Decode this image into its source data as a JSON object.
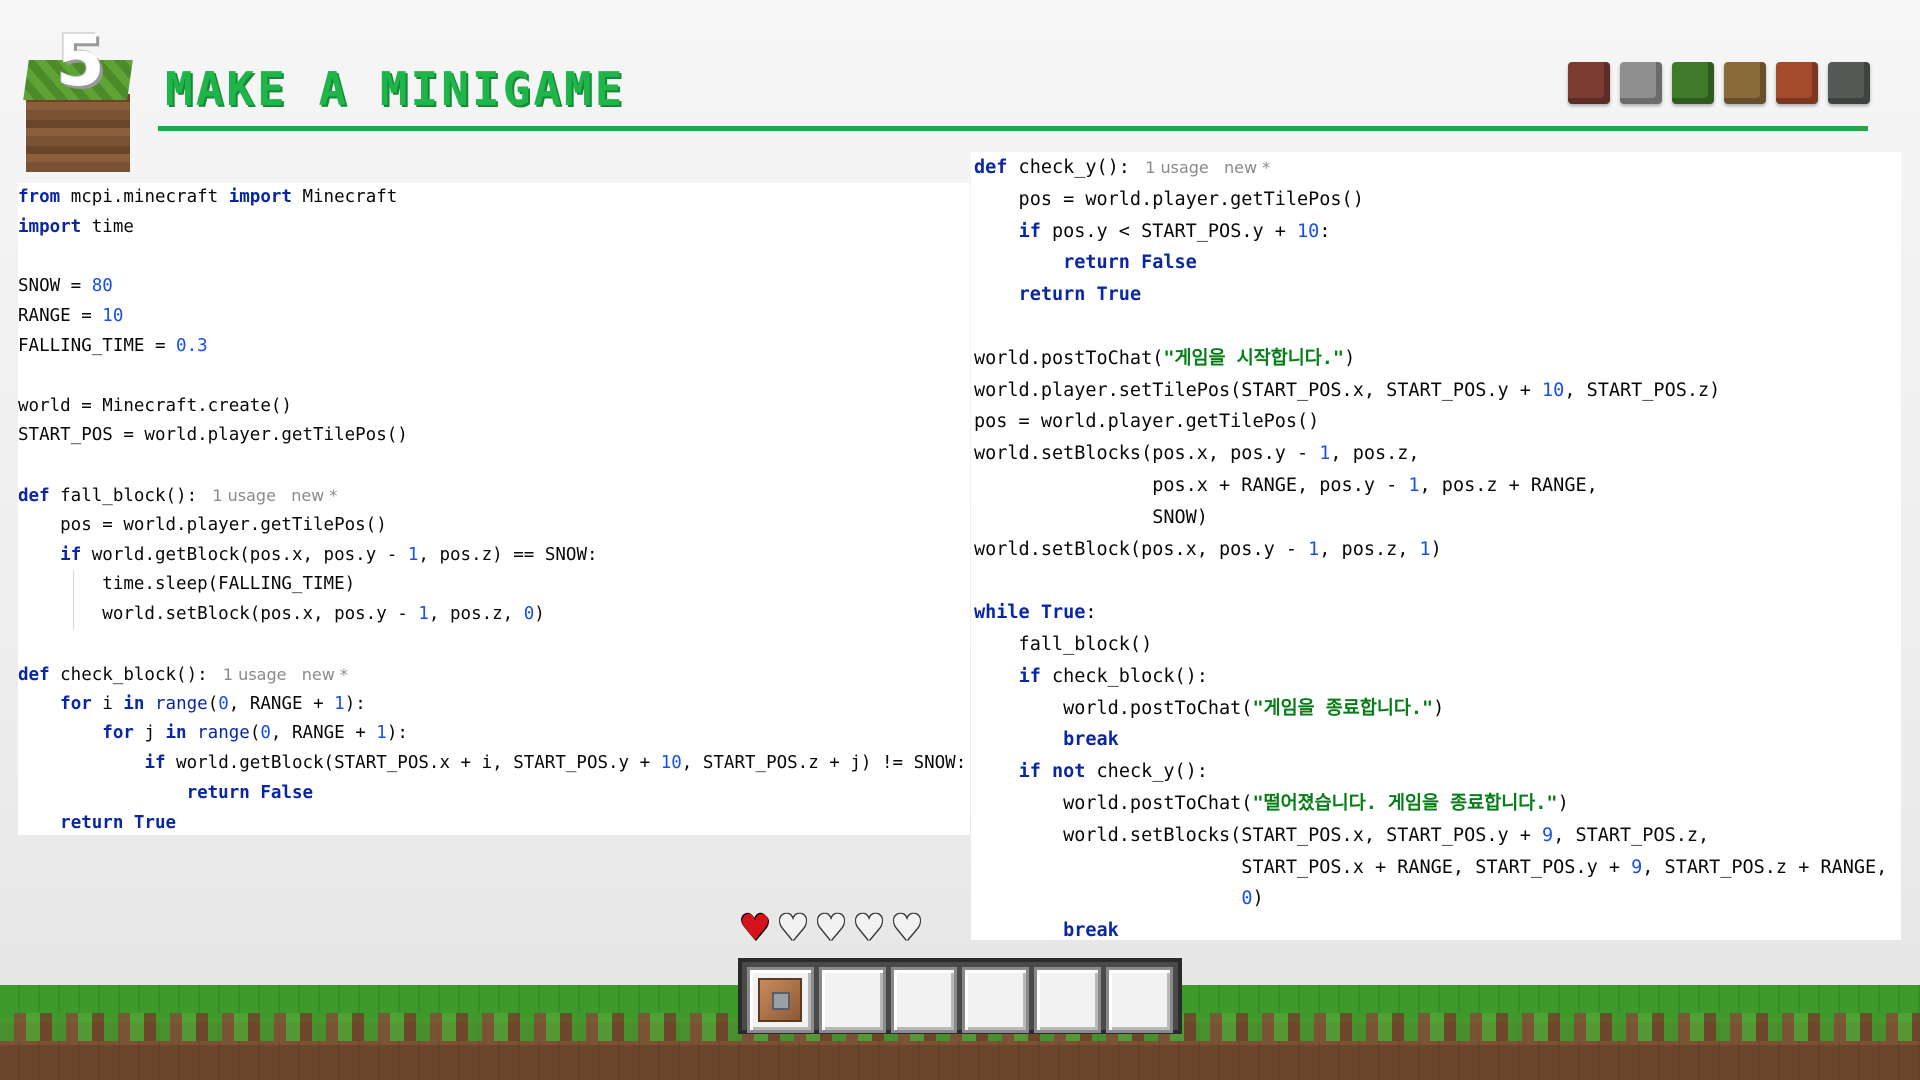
{
  "header": {
    "badge_number": "5",
    "title": "MAKE A MINIGAME",
    "block_icons": [
      {
        "name": "netherrack-block-icon",
        "color": "#7b3b33"
      },
      {
        "name": "stone-block-icon",
        "color": "#8f8f8f"
      },
      {
        "name": "grass-block-icon",
        "color": "#3f7a2a"
      },
      {
        "name": "wood-block-icon",
        "color": "#8a6a3a"
      },
      {
        "name": "clay-block-icon",
        "color": "#a54a2a"
      },
      {
        "name": "ore-block-icon",
        "color": "#555a56"
      }
    ]
  },
  "left_code": {
    "lines": [
      "from mcpi.minecraft import Minecraft",
      "import time",
      "",
      "SNOW = 80",
      "RANGE = 10",
      "FALLING_TIME = 0.3",
      "",
      "world = Minecraft.create()",
      "START_POS = world.player.getTilePos()",
      "",
      "def fall_block():",
      "    pos = world.player.getTilePos()",
      "    if world.getBlock(pos.x, pos.y - 1, pos.z) == SNOW:",
      "        time.sleep(FALLING_TIME)",
      "        world.setBlock(pos.x, pos.y - 1, pos.z, 0)",
      "",
      "def check_block():",
      "    for i in range(0, RANGE + 1):",
      "        for j in range(0, RANGE + 1):",
      "            if world.getBlock(START_POS.x + i, START_POS.y + 10, START_POS.z + j) != SNOW:",
      "                return False",
      "    return True"
    ],
    "hints": {
      "fall_block": "1 usage   new *",
      "check_block": "1 usage   new *"
    }
  },
  "right_code": {
    "lines": [
      "def check_y():",
      "    pos = world.player.getTilePos()",
      "    if pos.y < START_POS.y + 10:",
      "        return False",
      "    return True",
      "",
      "world.postToChat(\"게임을 시작합니다.\")",
      "world.player.setTilePos(START_POS.x, START_POS.y + 10, START_POS.z)",
      "pos = world.player.getTilePos()",
      "world.setBlocks(pos.x, pos.y - 1, pos.z,",
      "                pos.x + RANGE, pos.y - 1, pos.z + RANGE,",
      "                SNOW)",
      "world.setBlock(pos.x, pos.y - 1, pos.z, 1)",
      "",
      "while True:",
      "    fall_block()",
      "    if check_block():",
      "        world.postToChat(\"게임을 종료합니다.\")",
      "        break",
      "    if not check_y():",
      "        world.postToChat(\"떨어졌습니다. 게임을 종료합니다.\")",
      "        world.setBlocks(START_POS.x, START_POS.y + 9, START_POS.z,",
      "                        START_POS.x + RANGE, START_POS.y + 9, START_POS.z + RANGE,",
      "                        0)",
      "        break"
    ],
    "hints": {
      "check_y": "1 usage   new *"
    }
  },
  "hud": {
    "hearts_full": 1,
    "hearts_total": 5,
    "hotbar_slots": 6,
    "hotbar_item": "command-block-icon",
    "heart_glyph": "♥"
  }
}
